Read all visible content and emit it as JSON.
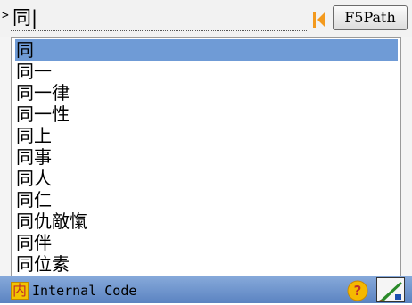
{
  "input": {
    "caret": ">",
    "query": "同|"
  },
  "toolbar": {
    "path_button_label": "F5Path"
  },
  "candidates": [
    "同",
    "同一",
    "同一律",
    "同一性",
    "同上",
    "同事",
    "同人",
    "同仁",
    "同仇敵愾",
    "同伴",
    "同位素"
  ],
  "selected_index": 0,
  "status": {
    "mode_icon_char": "内",
    "mode_label": "Internal Code",
    "icons": [
      "help-icon",
      "handwriting-pen-icon"
    ]
  },
  "colors": {
    "selection": "#6f9bd6",
    "status_bar": "#6e93cd",
    "back_arrow": "#f39a1e",
    "help_icon": "#f5b800"
  }
}
